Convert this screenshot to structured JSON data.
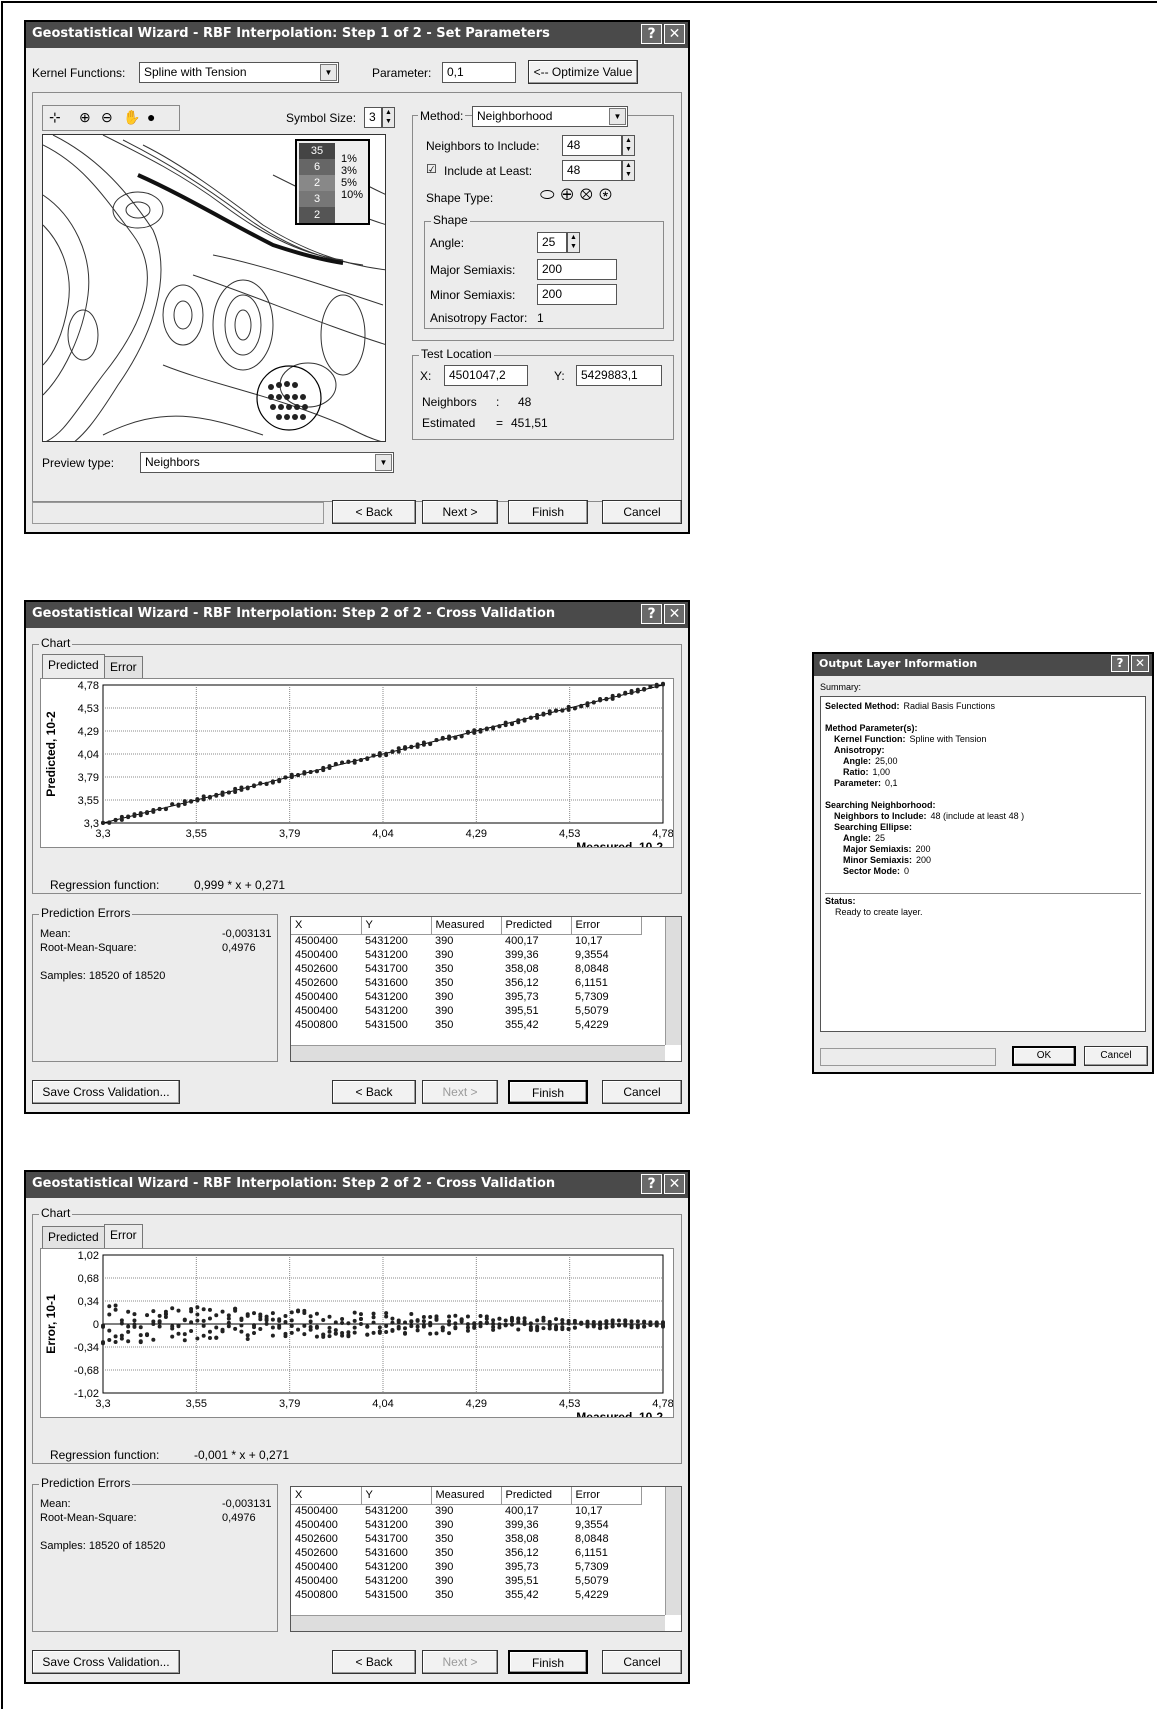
{
  "w1": {
    "title": "Geostatistical Wizard - RBF Interpolation: Step 1 of 2 - Set Parameters",
    "kernel_label": "Kernel Functions:",
    "kernel_value": "Spline with Tension",
    "parameter_label": "Parameter:",
    "parameter_value": "0,1",
    "optimize_label": "<-- Optimize Value",
    "symbol_size_label": "Symbol Size:",
    "symbol_size_value": "3",
    "method_label": "Method:",
    "method_value": "Neighborhood",
    "neighbors_label": "Neighbors to Include:",
    "neighbors_value": "48",
    "include_label": "Include at Least:",
    "include_value": "48",
    "shape_type_label": "Shape Type:",
    "shape_group": "Shape",
    "angle_label": "Angle:",
    "angle_value": "25",
    "major_label": "Major Semiaxis:",
    "major_value": "200",
    "minor_label": "Minor Semiaxis:",
    "minor_value": "200",
    "anis_label": "Anisotropy Factor:",
    "anis_value": "1",
    "test_group": "Test Location",
    "x_label": "X:",
    "x_value": "4501047,2",
    "y_label": "Y:",
    "y_value": "5429883,1",
    "nb_label": "Neighbors",
    "nb_sep": ":",
    "nb_value": "48",
    "est_label": "Estimated",
    "est_sep": "=",
    "est_value": "451,51",
    "preview_label": "Preview type:",
    "preview_value": "Neighbors",
    "legend_counts": [
      "35",
      "6",
      "2",
      "3",
      "2"
    ],
    "legend_pcts": [
      "1%",
      "3%",
      "5%",
      "10%"
    ],
    "back": "< Back",
    "next": "Next >",
    "finish": "Finish",
    "cancel": "Cancel"
  },
  "w2": {
    "title": "Geostatistical Wizard - RBF Interpolation: Step 2 of 2 - Cross Validation",
    "chart_group": "Chart",
    "tab_predicted": "Predicted",
    "tab_error": "Error",
    "ylabel": "Predicted, 10-2",
    "xlabel": "Measured, 10-2",
    "regression_label": "Regression function:",
    "regression_value": "0,999 * x + 0,271",
    "back": "< Back",
    "next": "Next >",
    "finish": "Finish",
    "cancel": "Cancel",
    "save": "Save Cross Validation..."
  },
  "w3": {
    "title": "Geostatistical Wizard - RBF Interpolation: Step 2 of 2 - Cross Validation",
    "chart_group": "Chart",
    "tab_predicted": "Predicted",
    "tab_error": "Error",
    "ylabel": "Error, 10-1",
    "xlabel": "Measured, 10-2",
    "regression_label": "Regression function:",
    "regression_value": "-0,001 * x + 0,271",
    "back": "< Back",
    "next": "Next >",
    "finish": "Finish",
    "cancel": "Cancel",
    "save": "Save Cross Validation..."
  },
  "pred_errors": {
    "group": "Prediction Errors",
    "mean_label": "Mean:",
    "mean_value": "-0,003131",
    "rms_label": "Root-Mean-Square:",
    "rms_value": "0,4976",
    "samples": "Samples: 18520 of 18520"
  },
  "table": {
    "headers": [
      "X",
      "Y",
      "Measured",
      "Predicted",
      "Error"
    ],
    "rows": [
      [
        "4500400",
        "5431200",
        "390",
        "400,17",
        "10,17"
      ],
      [
        "4500400",
        "5431200",
        "390",
        "399,36",
        "9,3554"
      ],
      [
        "4502600",
        "5431700",
        "350",
        "358,08",
        "8,0848"
      ],
      [
        "4502600",
        "5431600",
        "350",
        "356,12",
        "6,1151"
      ],
      [
        "4500400",
        "5431200",
        "390",
        "395,73",
        "5,7309"
      ],
      [
        "4500400",
        "5431200",
        "390",
        "395,51",
        "5,5079"
      ],
      [
        "4500800",
        "5431500",
        "350",
        "355,42",
        "5,4229"
      ]
    ]
  },
  "out": {
    "title": "Output Layer Information",
    "summary": "Summary:",
    "lines": [
      [
        "Selected Method:",
        "Radial Basis Functions"
      ],
      [
        "",
        ""
      ],
      [
        "Method Parameter(s):",
        ""
      ],
      [
        "   Kernel Function:",
        "Spline with Tension"
      ],
      [
        "   Anisotropy:",
        ""
      ],
      [
        "      Angle:",
        "25,00"
      ],
      [
        "      Ratio:",
        "1,00"
      ],
      [
        "   Parameter:",
        "0,1"
      ],
      [
        "",
        ""
      ],
      [
        "Searching Neighborhood:",
        ""
      ],
      [
        "   Neighbors to Include:",
        "48 (include at least 48 )"
      ],
      [
        "   Searching Ellipse:",
        ""
      ],
      [
        "      Angle:",
        "25"
      ],
      [
        "      Major Semiaxis:",
        "200"
      ],
      [
        "      Minor Semiaxis:",
        "200"
      ],
      [
        "      Sector Mode:",
        "0"
      ]
    ],
    "status_label": "Status:",
    "status_value": "Ready to create layer.",
    "ok": "OK",
    "cancel": "Cancel"
  },
  "chart_data": [
    {
      "type": "scatter",
      "title": "",
      "xlabel": "Measured, 10-2",
      "ylabel": "Predicted, 10-2",
      "xlim": [
        3.3,
        4.78
      ],
      "ylim": [
        3.3,
        4.78
      ],
      "xticks": [
        "3,3",
        "3,55",
        "3,79",
        "4,04",
        "4,29",
        "4,53",
        "4,78"
      ],
      "yticks": [
        "3,3",
        "3,55",
        "3,79",
        "4,04",
        "4,29",
        "4,53",
        "4,78"
      ],
      "regression": {
        "slope": 0.999,
        "intercept": 0.271
      },
      "grid": true
    },
    {
      "type": "scatter",
      "title": "",
      "xlabel": "Measured, 10-2",
      "ylabel": "Error, 10-1",
      "xlim": [
        3.3,
        4.78
      ],
      "ylim": [
        -1.02,
        1.02
      ],
      "xticks": [
        "3,3",
        "3,55",
        "3,79",
        "4,04",
        "4,29",
        "4,53",
        "4,78"
      ],
      "yticks": [
        "1,02",
        "0,68",
        "0,34",
        "0",
        "-0,34",
        "-0,68",
        "-1,02"
      ],
      "regression": {
        "slope": -0.001,
        "intercept": 0.271
      },
      "grid": true
    }
  ]
}
